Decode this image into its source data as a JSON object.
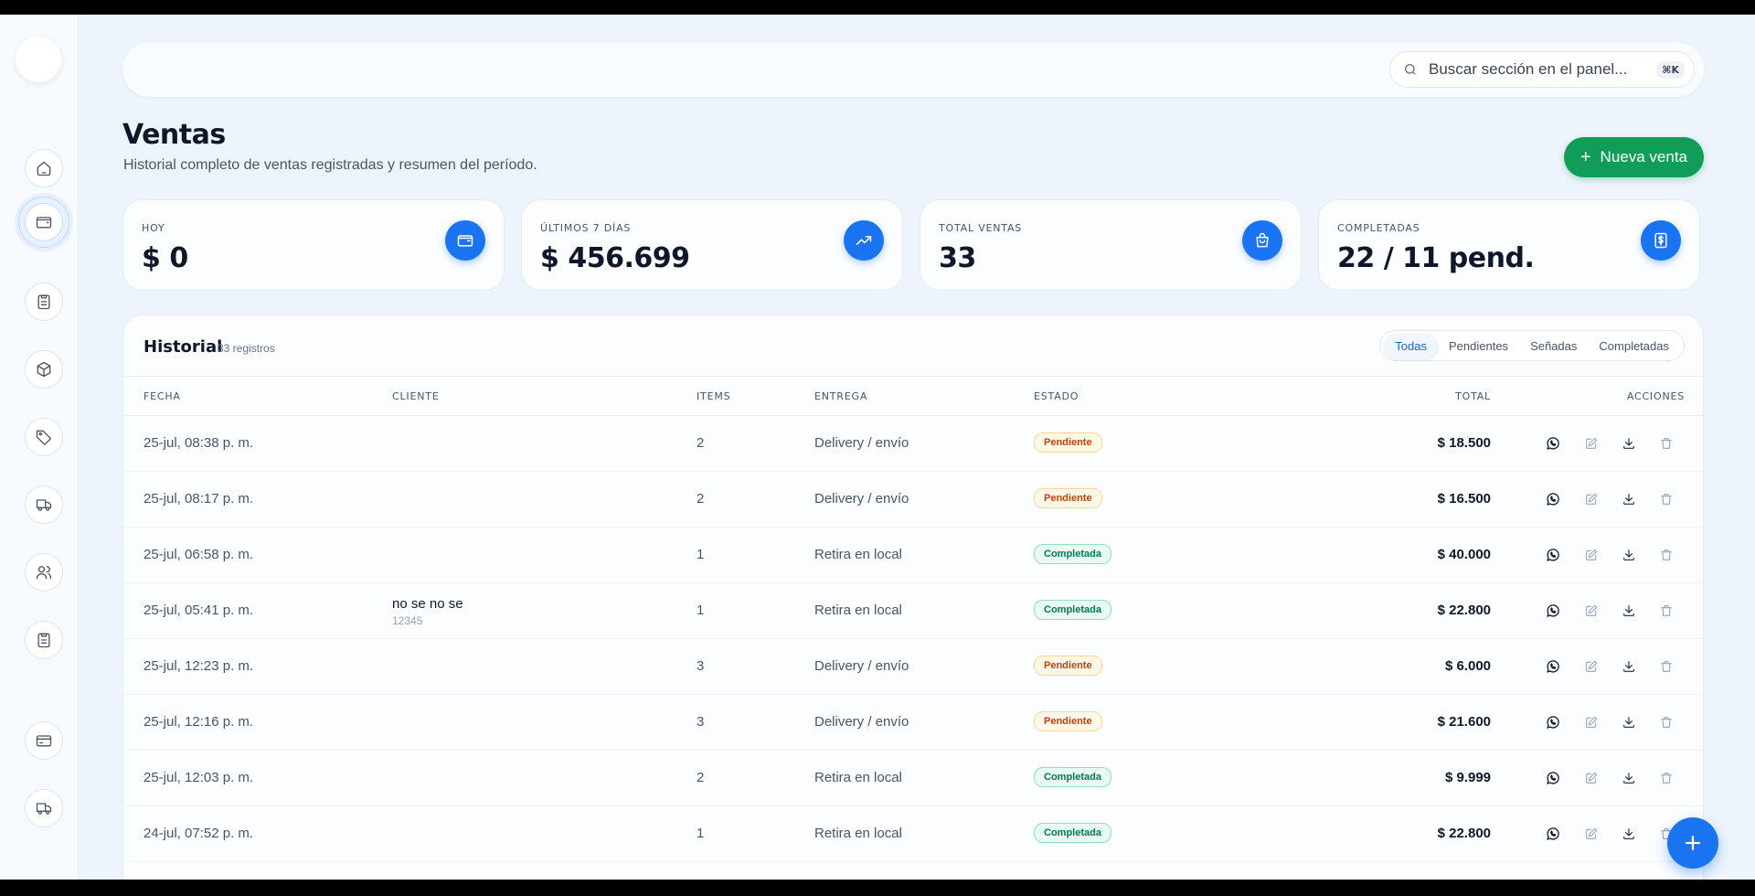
{
  "search": {
    "placeholder": "Buscar sección en el panel...",
    "shortcut": "⌘K"
  },
  "sidebar": {
    "items": [
      {
        "icon": "home-icon"
      },
      {
        "icon": "wallet-icon",
        "active": true
      },
      {
        "icon": "clipboard-icon"
      },
      {
        "icon": "box-icon"
      },
      {
        "icon": "tag-icon"
      },
      {
        "icon": "truck-icon"
      },
      {
        "icon": "users-icon"
      },
      {
        "icon": "clipboard-icon"
      },
      {
        "icon": "credit-card-icon"
      },
      {
        "icon": "truck-icon"
      }
    ]
  },
  "header": {
    "title": "Ventas",
    "subtitle": "Historial completo de ventas registradas y resumen del período.",
    "new_button": "Nueva venta"
  },
  "stats": [
    {
      "label": "HOY",
      "value": "$ 0",
      "icon": "wallet-icon"
    },
    {
      "label": "ÚLTIMOS 7 DÍAS",
      "value": "$ 456.699",
      "icon": "trending-up-icon"
    },
    {
      "label": "TOTAL VENTAS",
      "value": "33",
      "icon": "shopping-bag-icon"
    },
    {
      "label": "COMPLETADAS",
      "value": "22 / 11 pend.",
      "icon": "dollar-receipt-icon"
    }
  ],
  "history": {
    "title": "Historial",
    "count": "33 registros",
    "tabs": [
      "Todas",
      "Pendientes",
      "Señadas",
      "Completadas"
    ],
    "active_tab": "Todas",
    "columns": {
      "fecha": "FECHA",
      "cliente": "CLIENTE",
      "items": "ITEMS",
      "entrega": "ENTREGA",
      "estado": "ESTADO",
      "total": "TOTAL",
      "acciones": "ACCIONES"
    },
    "rows": [
      {
        "fecha": "25-jul, 08:38 p. m.",
        "cliente": "",
        "telefono": "",
        "items": "2",
        "entrega": "Delivery / envío",
        "estado": "Pendiente",
        "total": "$ 18.500"
      },
      {
        "fecha": "25-jul, 08:17 p. m.",
        "cliente": "",
        "telefono": "",
        "items": "2",
        "entrega": "Delivery / envío",
        "estado": "Pendiente",
        "total": "$ 16.500"
      },
      {
        "fecha": "25-jul, 06:58 p. m.",
        "cliente": "",
        "telefono": "",
        "items": "1",
        "entrega": "Retira en local",
        "estado": "Completada",
        "total": "$ 40.000"
      },
      {
        "fecha": "25-jul, 05:41 p. m.",
        "cliente": "no se no se",
        "telefono": "12345",
        "items": "1",
        "entrega": "Retira en local",
        "estado": "Completada",
        "total": "$ 22.800"
      },
      {
        "fecha": "25-jul, 12:23 p. m.",
        "cliente": "",
        "telefono": "",
        "items": "3",
        "entrega": "Delivery / envío",
        "estado": "Pendiente",
        "total": "$ 6.000"
      },
      {
        "fecha": "25-jul, 12:16 p. m.",
        "cliente": "",
        "telefono": "",
        "items": "3",
        "entrega": "Delivery / envío",
        "estado": "Pendiente",
        "total": "$ 21.600"
      },
      {
        "fecha": "25-jul, 12:03 p. m.",
        "cliente": "",
        "telefono": "",
        "items": "2",
        "entrega": "Retira en local",
        "estado": "Completada",
        "total": "$ 9.999"
      },
      {
        "fecha": "24-jul, 07:52 p. m.",
        "cliente": "",
        "telefono": "",
        "items": "1",
        "entrega": "Retira en local",
        "estado": "Completada",
        "total": "$ 22.800"
      }
    ]
  },
  "colors": {
    "primary": "#1a73f0",
    "success": "#0f9d58",
    "pending": "#c2410c",
    "completed": "#047857"
  }
}
